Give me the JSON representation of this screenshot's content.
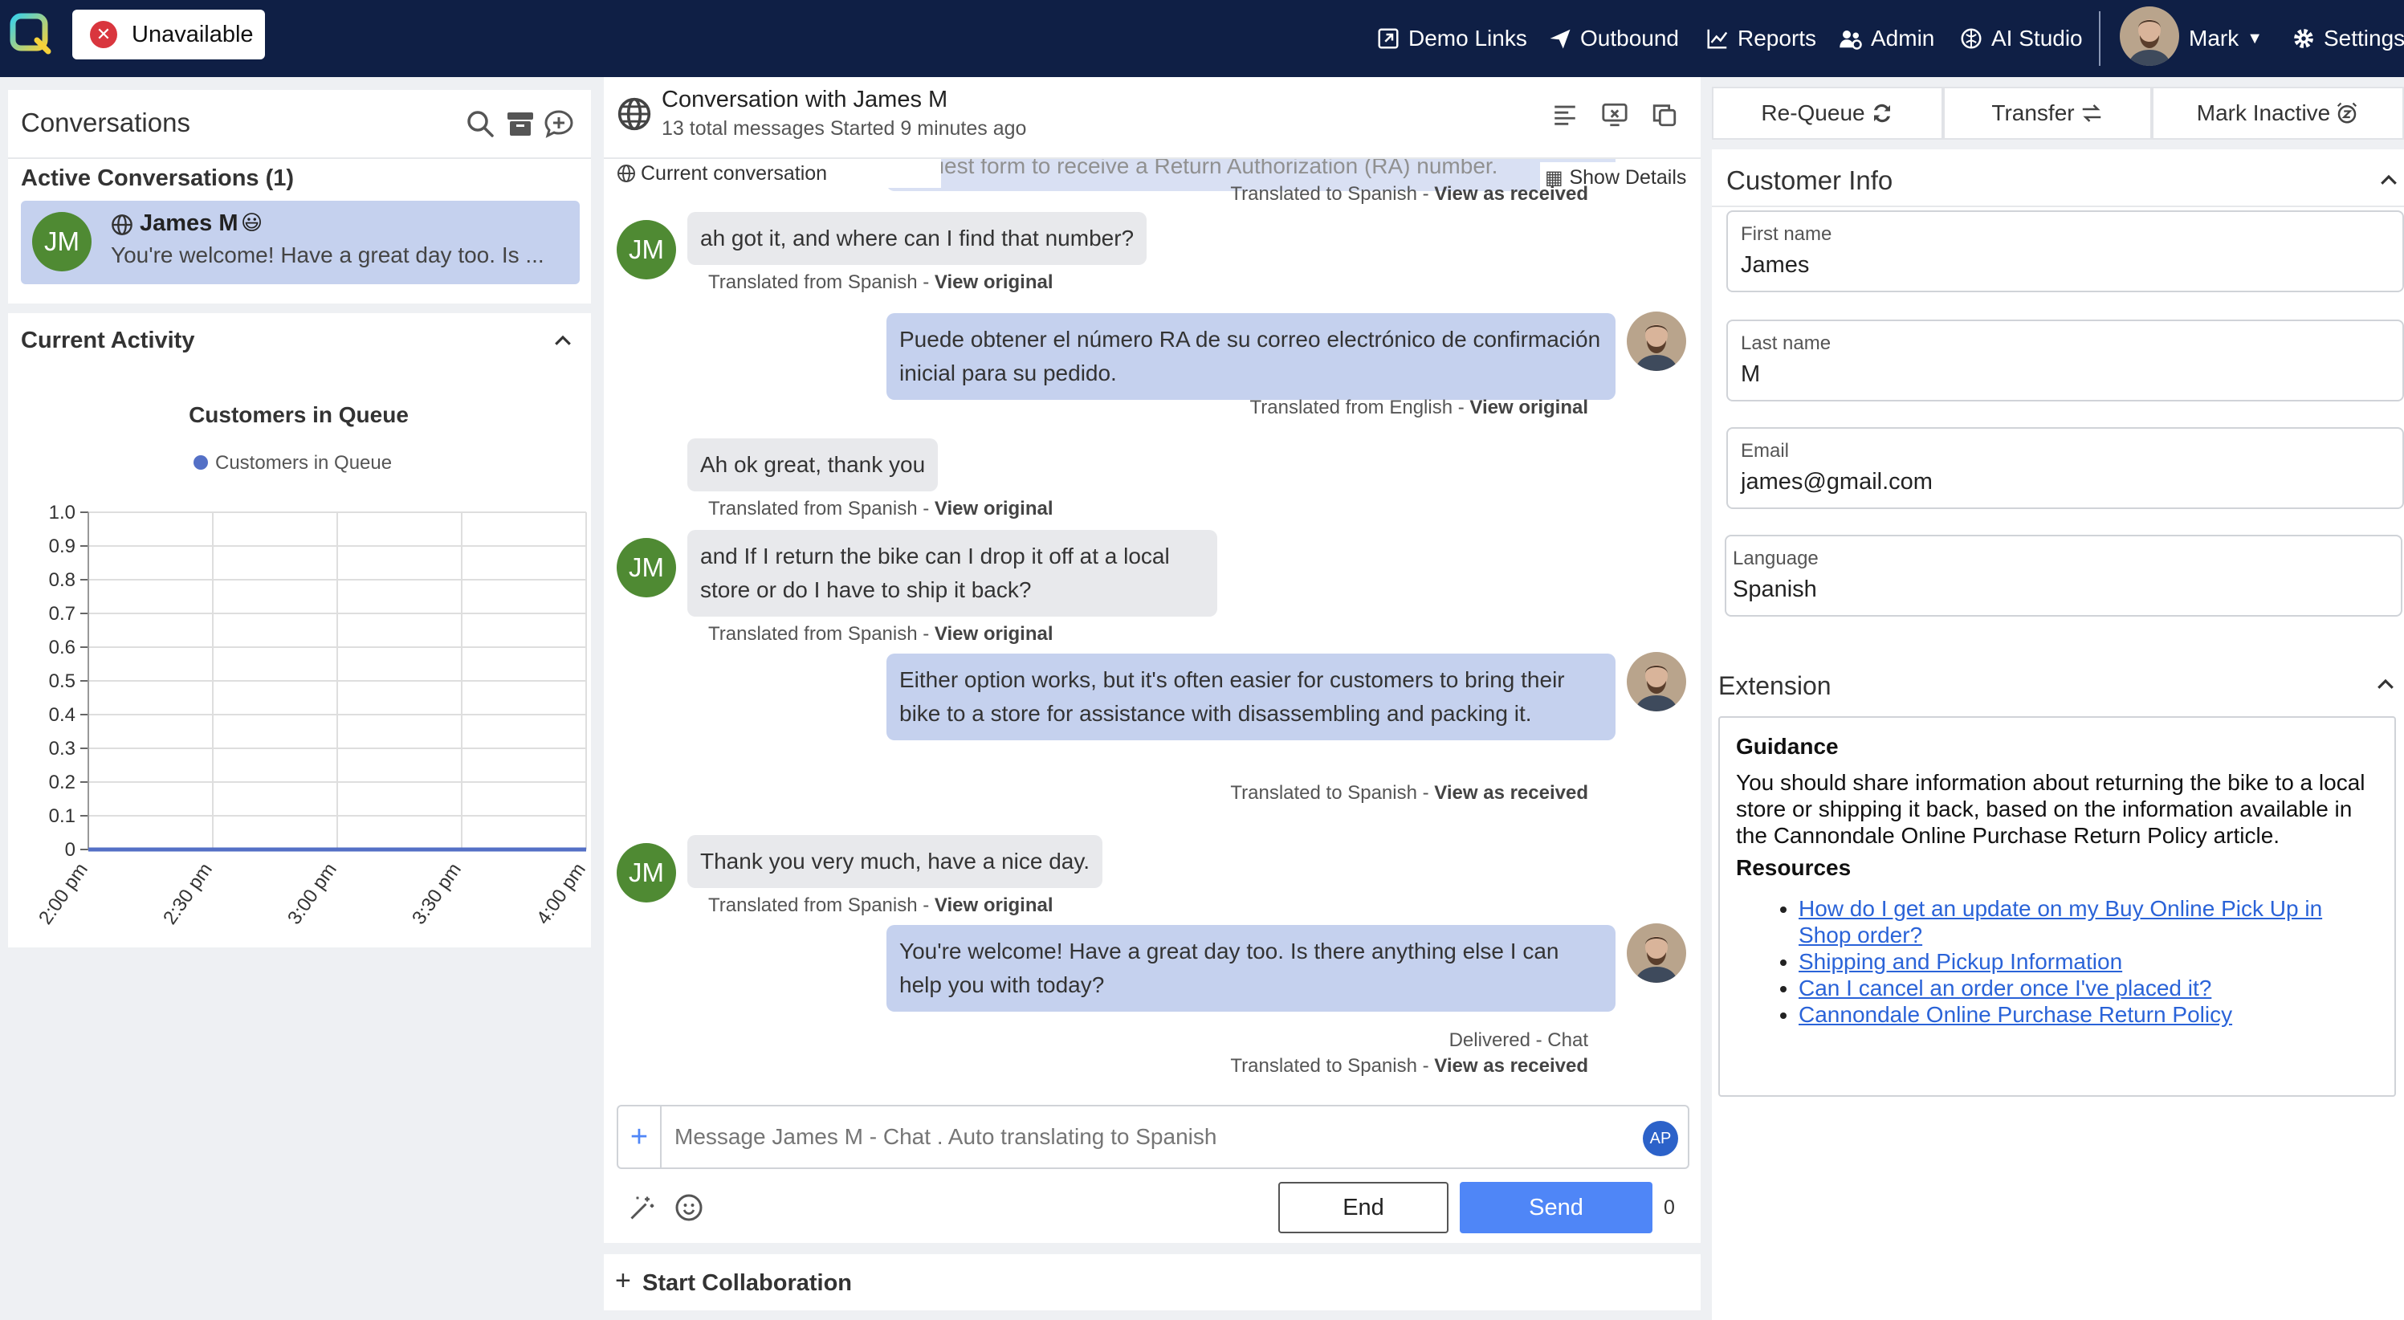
{
  "topbar": {
    "status_label": "Unavailable",
    "nav": {
      "demo_links": "Demo Links",
      "outbound": "Outbound",
      "reports": "Reports",
      "admin": "Admin",
      "ai_studio": "AI Studio",
      "user": "Mark",
      "settings": "Settings"
    }
  },
  "conversations": {
    "title": "Conversations",
    "active_header": "Active Conversations (1)",
    "items": [
      {
        "initials": "JM",
        "name": "James M",
        "emoji": "😃",
        "preview": "You're welcome! Have a great day too. Is ..."
      }
    ]
  },
  "activity": {
    "title": "Current Activity"
  },
  "chart_data": {
    "type": "line",
    "title": "Customers in Queue",
    "series": [
      {
        "name": "Customers in Queue",
        "color": "#5470c6",
        "values": [
          0,
          0,
          0,
          0,
          0
        ]
      }
    ],
    "x": [
      "2:00 pm",
      "2:30 pm",
      "3:00 pm",
      "3:30 pm",
      "4:00 pm"
    ],
    "yticks": [
      "1.0",
      "0.9",
      "0.8",
      "0.7",
      "0.6",
      "0.5",
      "0.4",
      "0.3",
      "0.2",
      "0.1",
      "0"
    ],
    "ylim": [
      0,
      1
    ],
    "grid": true,
    "legend": "top"
  },
  "conversation": {
    "title": "Conversation with James M",
    "subtitle": "13 total messages Started 9 minutes ago",
    "current_label": "Current conversation",
    "show_details": "Show Details",
    "partial_top": "request form to receive a Return Authorization (RA) number.",
    "messages": [
      {
        "text": "ah got it, and where can I find that number?",
        "meta": "Translated from Spanish - ",
        "action": "View original"
      },
      {
        "text": "Puede obtener el número RA de su correo electrónico de confirmación inicial para su pedido.",
        "meta": "Translated from English - ",
        "action": "View original"
      },
      {
        "text": "Ah ok great, thank you",
        "meta": "Translated from Spanish - ",
        "action": "View original"
      },
      {
        "text": "and If I return the bike can I drop it off at a local store or do I have to ship it back?",
        "meta": "Translated from Spanish - ",
        "action": "View original"
      },
      {
        "text": "Either option works, but it's often easier for customers to bring their bike to a store for assistance with disassembling and packing it.",
        "meta": "Translated to Spanish - ",
        "action": "View as received"
      },
      {
        "text": "Thank you very much, have a nice day.",
        "meta": "Translated from Spanish - ",
        "action": "View original"
      },
      {
        "text": "You're welcome! Have a great day too. Is there anything else I can help you with today?",
        "meta": "Translated to Spanish - ",
        "action": "View as received",
        "delivered": "Delivered - Chat"
      }
    ],
    "top_meta": "Translated to Spanish - ",
    "top_action": "View as received",
    "input_placeholder": "Message James M - Chat . Auto translating to Spanish",
    "input_badge": "AP",
    "end_label": "End",
    "send_label": "Send",
    "char_count": "0",
    "collab_label": "Start Collaboration"
  },
  "actions": {
    "requeue": "Re-Queue",
    "transfer": "Transfer",
    "mark_inactive": "Mark Inactive"
  },
  "customer": {
    "title": "Customer Info",
    "fields": [
      {
        "label": "First name",
        "value": "James"
      },
      {
        "label": "Last name",
        "value": "M"
      },
      {
        "label": "Email",
        "value": "james@gmail.com"
      },
      {
        "label": "Language",
        "value": "Spanish"
      }
    ]
  },
  "extension": {
    "title": "Extension",
    "guidance_title": "Guidance",
    "guidance_text": "You should share information about returning the bike to a local store or shipping it back, based on the information available in the Cannondale Online Purchase Return Policy article.",
    "resources_title": "Resources",
    "links": [
      "How do I get an update on my Buy Online Pick Up in Shop order?",
      "Shipping and Pickup Information",
      "Can I cancel an order once I've placed it?",
      "Cannondale Online Purchase Return Policy"
    ]
  },
  "colors": {
    "topbar": "#0f1f45",
    "accent": "#4f86f7",
    "agent_bubble": "#c5d1ee",
    "avatar_green": "#4f8a33",
    "status_red": "#d9363e"
  }
}
